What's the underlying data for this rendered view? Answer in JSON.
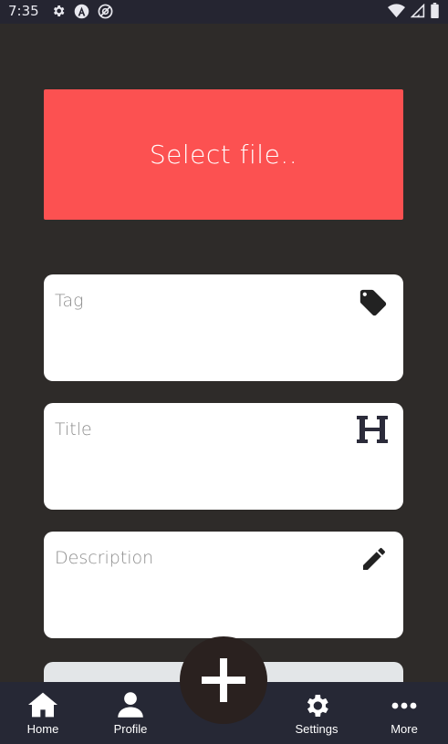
{
  "status_bar": {
    "time": "7:35",
    "icons_left": [
      "gear-icon",
      "a-icon",
      "at-icon"
    ],
    "icons_right": [
      "wifi-icon",
      "signal-icon",
      "battery-icon"
    ]
  },
  "upload": {
    "select_file_label": "Select file.."
  },
  "form": {
    "tag_label": "Tag",
    "title_label": "Title",
    "description_label": "Description"
  },
  "bottom_nav": {
    "home": "Home",
    "profile": "Profile",
    "settings": "Settings",
    "more": "More"
  },
  "colors": {
    "background": "#2e2b29",
    "accent": "#fc5151",
    "nav_background": "#262835",
    "fab_background": "#2a211f"
  }
}
